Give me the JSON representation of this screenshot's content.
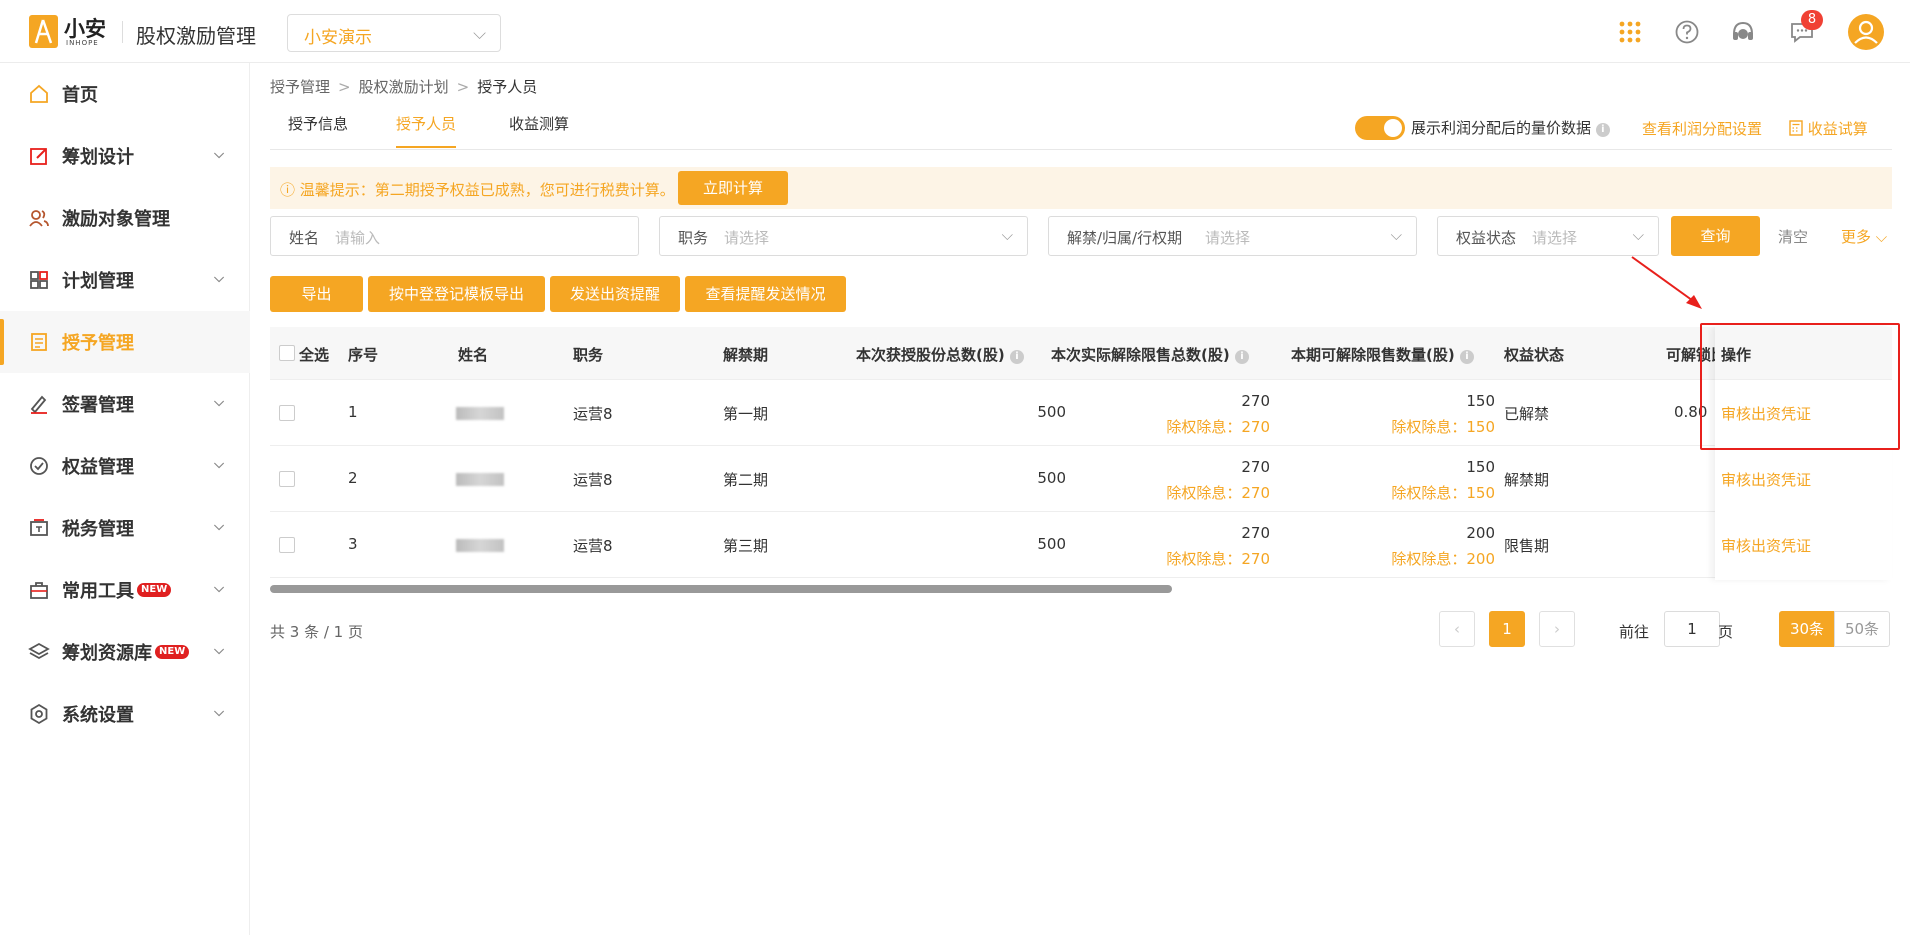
{
  "header": {
    "logo_text": "小安",
    "logo_sub": "INHOPE",
    "system_title": "股权激励管理",
    "company": "小安演示",
    "notification_count": "8"
  },
  "sidebar": {
    "items": [
      {
        "label": "首页",
        "icon": "home-icon"
      },
      {
        "label": "筹划设计",
        "icon": "edit-icon"
      },
      {
        "label": "激励对象管理",
        "icon": "users-icon"
      },
      {
        "label": "计划管理",
        "icon": "grid-icon"
      },
      {
        "label": "授予管理",
        "icon": "book-icon"
      },
      {
        "label": "签署管理",
        "icon": "sign-icon"
      },
      {
        "label": "权益管理",
        "icon": "shield-icon"
      },
      {
        "label": "税务管理",
        "icon": "tax-icon"
      },
      {
        "label": "常用工具",
        "icon": "toolbox-icon",
        "tag": "NEW"
      },
      {
        "label": "筹划资源库",
        "icon": "layers-icon",
        "tag": "NEW"
      },
      {
        "label": "系统设置",
        "icon": "settings-icon"
      }
    ]
  },
  "breadcrumb": [
    "授予管理",
    "股权激励计划",
    "授予人员"
  ],
  "tabs": [
    "授予信息",
    "授予人员",
    "收益测算"
  ],
  "toolbar": {
    "switch_label": "展示利润分配后的量价数据",
    "view_settings_link": "查看利润分配设置",
    "income_calc_link": "收益试算"
  },
  "notice": {
    "text": "温馨提示：第二期授予权益已成熟，您可进行税费计算。",
    "button": "立即计算"
  },
  "filters": {
    "name_label": "姓名",
    "name_placeholder": "请输入",
    "position_label": "职务",
    "position_placeholder": "请选择",
    "period_label": "解禁/归属/行权期",
    "period_placeholder": "请选择",
    "status_label": "权益状态",
    "status_placeholder": "请选择",
    "query": "查询",
    "clear": "清空",
    "more": "更多"
  },
  "actions": [
    "导出",
    "按中登登记模板导出",
    "发送出资提醒",
    "查看提醒发送情况"
  ],
  "table": {
    "headers": {
      "select_all": "全选",
      "index": "序号",
      "name": "姓名",
      "position": "职务",
      "period": "解禁期",
      "total": "本次获授股份总数(股)",
      "released": "本次实际解除限售总数(股)",
      "releasable": "本期可解除限售数量(股)",
      "status": "权益状态",
      "lockup": "可解锁比",
      "ops": "操作"
    },
    "rows": [
      {
        "index": "1",
        "position": "运营8",
        "period": "第一期",
        "total": "500",
        "released": "270",
        "released_sub": "除权除息：270",
        "releasable": "150",
        "releasable_sub": "除权除息：150",
        "status": "已解禁",
        "lockup": "0.80",
        "op": "审核出资凭证"
      },
      {
        "index": "2",
        "position": "运营8",
        "period": "第二期",
        "total": "500",
        "released": "270",
        "released_sub": "除权除息：270",
        "releasable": "150",
        "releasable_sub": "除权除息：150",
        "status": "解禁期",
        "lockup": "",
        "op": "审核出资凭证"
      },
      {
        "index": "3",
        "position": "运营8",
        "period": "第三期",
        "total": "500",
        "released": "270",
        "released_sub": "除权除息：270",
        "releasable": "200",
        "releasable_sub": "除权除息：200",
        "status": "限售期",
        "lockup": "",
        "op": "审核出资凭证"
      }
    ]
  },
  "pagination": {
    "summary": "共 3 条 / 1 页",
    "current": "1",
    "goto_label": "前往",
    "goto_value": "1",
    "page_unit": "页",
    "size_30": "30条",
    "size_50": "50条"
  },
  "colors": {
    "accent": "#f5a623",
    "highlight": "#e8201c"
  }
}
